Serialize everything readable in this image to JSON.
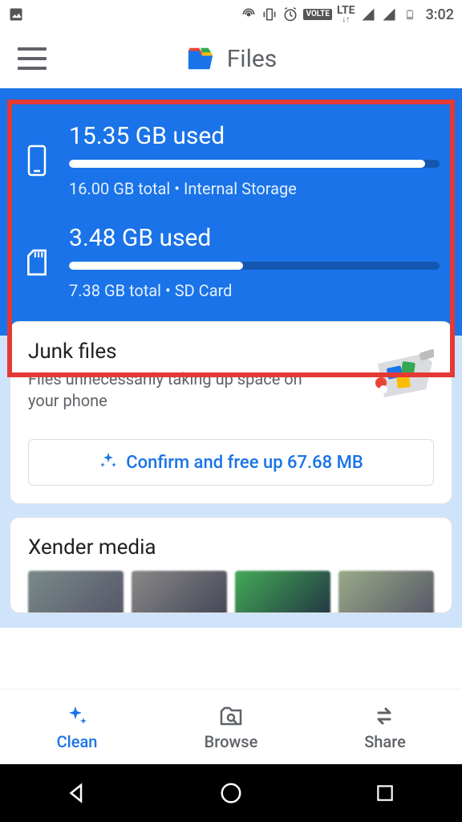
{
  "status_bar": {
    "time": "3:02"
  },
  "app_bar": {
    "title": "Files"
  },
  "storage": [
    {
      "used_label": "15.35 GB used",
      "sub_label": "16.00 GB total • Internal Storage",
      "fill_pct": 96
    },
    {
      "used_label": "3.48 GB used",
      "sub_label": "7.38 GB total • SD Card",
      "fill_pct": 47
    }
  ],
  "junk_card": {
    "title": "Junk files",
    "subtitle": "Files unnecessarily taking up space on your phone",
    "button_label": "Confirm and free up 67.68 MB"
  },
  "xender_card": {
    "title": "Xender media"
  },
  "bottom_nav": {
    "clean": "Clean",
    "browse": "Browse",
    "share": "Share"
  }
}
